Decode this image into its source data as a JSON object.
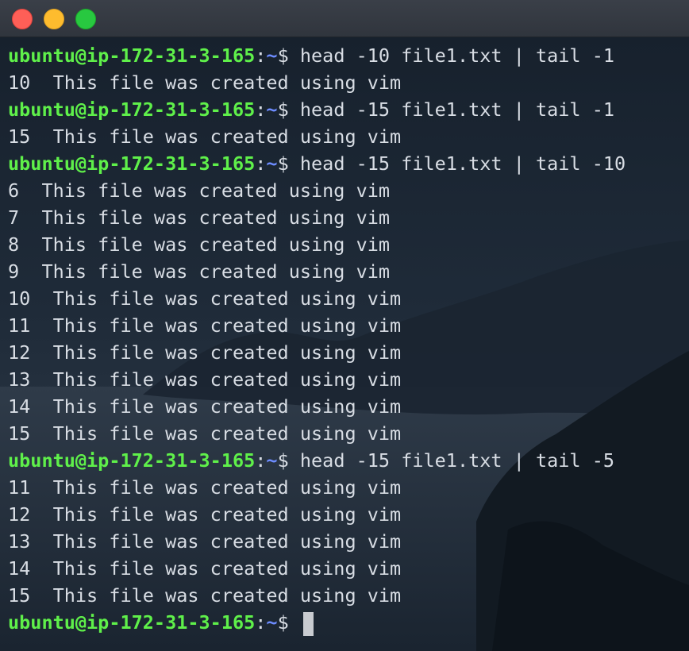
{
  "window": {
    "controls": [
      "close",
      "minimize",
      "zoom"
    ],
    "colors": {
      "close": "#fe5f57",
      "minimize": "#febc2e",
      "zoom": "#28c840"
    }
  },
  "terminal": {
    "prompt": {
      "user_host": "ubuntu@ip-172-31-3-165",
      "separator": ":",
      "path": "~",
      "symbol": "$ "
    },
    "colors": {
      "prompt_user": "#5ff04a",
      "prompt_path": "#6d8cff",
      "text": "#d8dde4"
    },
    "lines": [
      {
        "type": "prompt",
        "command": "head -10 file1.txt | tail -1"
      },
      {
        "type": "output",
        "text": "10  This file was created using vim"
      },
      {
        "type": "prompt",
        "command": "head -15 file1.txt | tail -1"
      },
      {
        "type": "output",
        "text": "15  This file was created using vim"
      },
      {
        "type": "prompt",
        "command": "head -15 file1.txt | tail -10"
      },
      {
        "type": "output",
        "text": "6  This file was created using vim"
      },
      {
        "type": "output",
        "text": "7  This file was created using vim"
      },
      {
        "type": "output",
        "text": "8  This file was created using vim"
      },
      {
        "type": "output",
        "text": "9  This file was created using vim"
      },
      {
        "type": "output",
        "text": "10  This file was created using vim"
      },
      {
        "type": "output",
        "text": "11  This file was created using vim"
      },
      {
        "type": "output",
        "text": "12  This file was created using vim"
      },
      {
        "type": "output",
        "text": "13  This file was created using vim"
      },
      {
        "type": "output",
        "text": "14  This file was created using vim"
      },
      {
        "type": "output",
        "text": "15  This file was created using vim"
      },
      {
        "type": "prompt",
        "command": "head -15 file1.txt | tail -5"
      },
      {
        "type": "output",
        "text": "11  This file was created using vim"
      },
      {
        "type": "output",
        "text": "12  This file was created using vim"
      },
      {
        "type": "output",
        "text": "13  This file was created using vim"
      },
      {
        "type": "output",
        "text": "14  This file was created using vim"
      },
      {
        "type": "output",
        "text": "15  This file was created using vim"
      },
      {
        "type": "prompt",
        "command": "",
        "cursor": true
      }
    ]
  }
}
